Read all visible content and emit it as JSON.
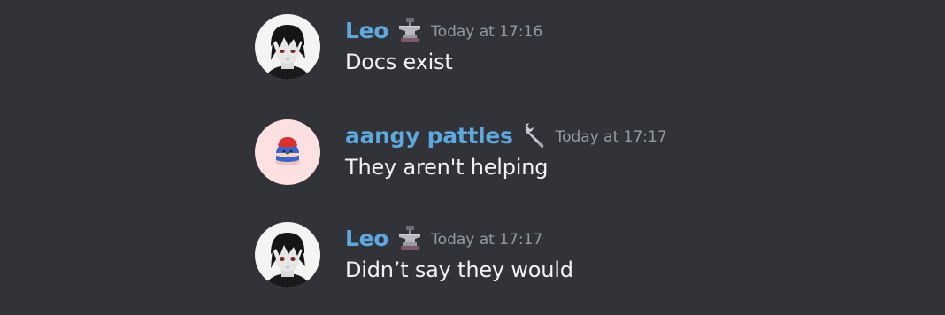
{
  "messages": [
    {
      "author": "Leo",
      "avatar_icon": "anime-boy-avatar-icon",
      "role_icon": "anvil-icon",
      "timestamp": "Today at 17:16",
      "content": "Docs exist"
    },
    {
      "author": "aangy pattles",
      "avatar_icon": "cartoon-character-avatar-icon",
      "role_icon": "wrench-icon",
      "timestamp": "Today at 17:17",
      "content": "They aren't helping"
    },
    {
      "author": "Leo",
      "avatar_icon": "anime-boy-avatar-icon",
      "role_icon": "anvil-icon",
      "timestamp": "Today at 17:17",
      "content": "Didn’t say they would"
    }
  ],
  "colors": {
    "background": "#313338",
    "username": "#5fa8dd",
    "timestamp": "#949ba4",
    "message_text": "#f2f3f5",
    "avatar_pink_bg": "#fde0e1"
  }
}
